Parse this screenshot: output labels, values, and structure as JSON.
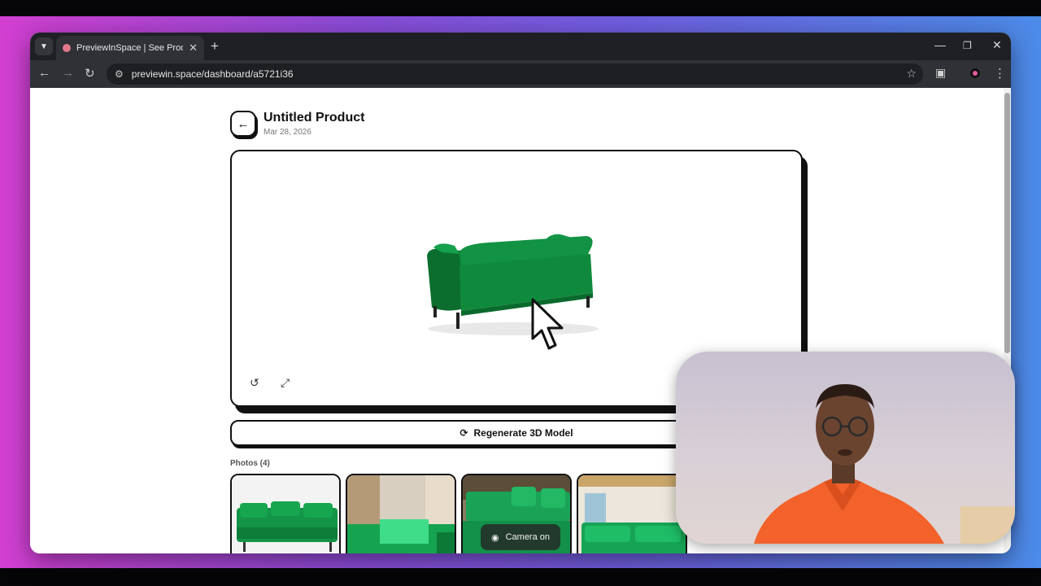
{
  "browser": {
    "tab_title": "PreviewInSpace | See Products",
    "url": "previewin.space/dashboard/a5721i36",
    "icons": [
      "tab-search-icon",
      "close-icon",
      "plus-icon",
      "minimize-icon",
      "restore-icon",
      "close-window-icon",
      "back-arrow-icon",
      "forward-arrow-icon",
      "reload-icon",
      "site-info-icon",
      "star-icon",
      "extensions-icon",
      "profile-icon",
      "kebab-menu-icon"
    ]
  },
  "product": {
    "title": "Untitled Product",
    "date": "Mar 28, 2026"
  },
  "viewer": {
    "icons": [
      "rotate-reset-icon",
      "fullscreen-icon"
    ],
    "model_color": "#0f8a3c"
  },
  "actions": {
    "regenerate_label": "Regenerate 3D Model"
  },
  "photos": {
    "label": "Photos (4)",
    "count": 4
  },
  "camera": {
    "label": "Camera on"
  },
  "colors": {
    "accent_dark": "#111111",
    "sofa_green": "#0f8a3c",
    "webcam_shirt": "#f2622a"
  }
}
